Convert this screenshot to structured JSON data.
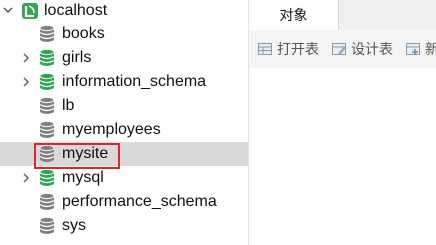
{
  "sidebar": {
    "connection": {
      "label": "localhost",
      "expanded": true,
      "icon": "connection-icon",
      "color": "#2fa84f"
    },
    "databases": [
      {
        "label": "books",
        "expandable": false,
        "active": false
      },
      {
        "label": "girls",
        "expandable": true,
        "active": true
      },
      {
        "label": "information_schema",
        "expandable": true,
        "active": true
      },
      {
        "label": "lb",
        "expandable": false,
        "active": false
      },
      {
        "label": "myemployees",
        "expandable": false,
        "active": false
      },
      {
        "label": "mysite",
        "expandable": false,
        "active": false,
        "selected": true
      },
      {
        "label": "mysql",
        "expandable": true,
        "active": true
      },
      {
        "label": "performance_schema",
        "expandable": false,
        "active": false
      },
      {
        "label": "sys",
        "expandable": false,
        "active": false
      }
    ],
    "colors": {
      "active_db": "#2fa84f",
      "inactive_db": "#808080",
      "selection_bg": "#d9d9d9",
      "highlight_border": "#e0242b"
    }
  },
  "main": {
    "tabs": [
      {
        "label": "对象",
        "active": true
      }
    ],
    "toolbar": {
      "open_table": "打开表",
      "design_table": "设计表",
      "new_table": "新"
    }
  }
}
